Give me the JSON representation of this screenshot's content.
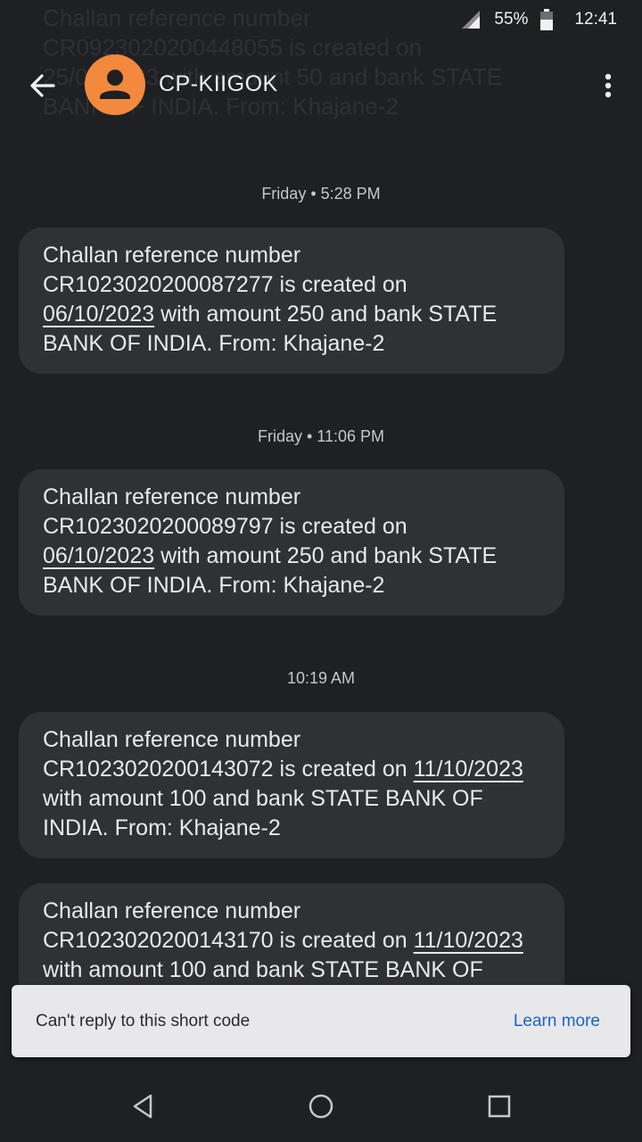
{
  "background_ghost_text": "Challan reference number\nCR0923020200448055 is created on\n25/09/2023 with amount 50 and bank STATE\nBANK OF INDIA. From: Khajane-2",
  "status_bar": {
    "battery": "55%",
    "time": "12:41"
  },
  "app_bar": {
    "contact_name": "CP-KIIGOK"
  },
  "messages": [
    {
      "timestamp": "Friday • 5:28 PM",
      "lines": [
        "Challan reference number",
        "CR1023020200087277 is created on",
        "06/10/2023",
        " with amount 250 and bank STATE",
        "BANK OF INDIA. From: Khajane-2"
      ]
    },
    {
      "timestamp": "Friday • 11:06 PM",
      "lines": [
        "Challan reference number",
        "CR1023020200089797 is created on",
        "06/10/2023",
        " with amount 250 and bank STATE",
        "BANK OF INDIA. From: Khajane-2"
      ]
    },
    {
      "timestamp": "10:19 AM",
      "lines": [
        "Challan reference number",
        "CR1023020200143072 is created on ",
        "11/10/2023",
        "with amount 100 and bank STATE BANK OF",
        "INDIA. From: Khajane-2"
      ]
    },
    {
      "lines": [
        "Challan reference number",
        "CR1023020200143170 is created on ",
        "11/10/2023",
        "with amount 100 and bank STATE BANK OF"
      ]
    }
  ],
  "snackbar": {
    "message": "Can't reply to this short code",
    "action": "Learn more"
  },
  "colors": {
    "background": "#1f2023",
    "bubble": "#303134",
    "avatar": "#f3893d",
    "link": "#1a64c8"
  }
}
